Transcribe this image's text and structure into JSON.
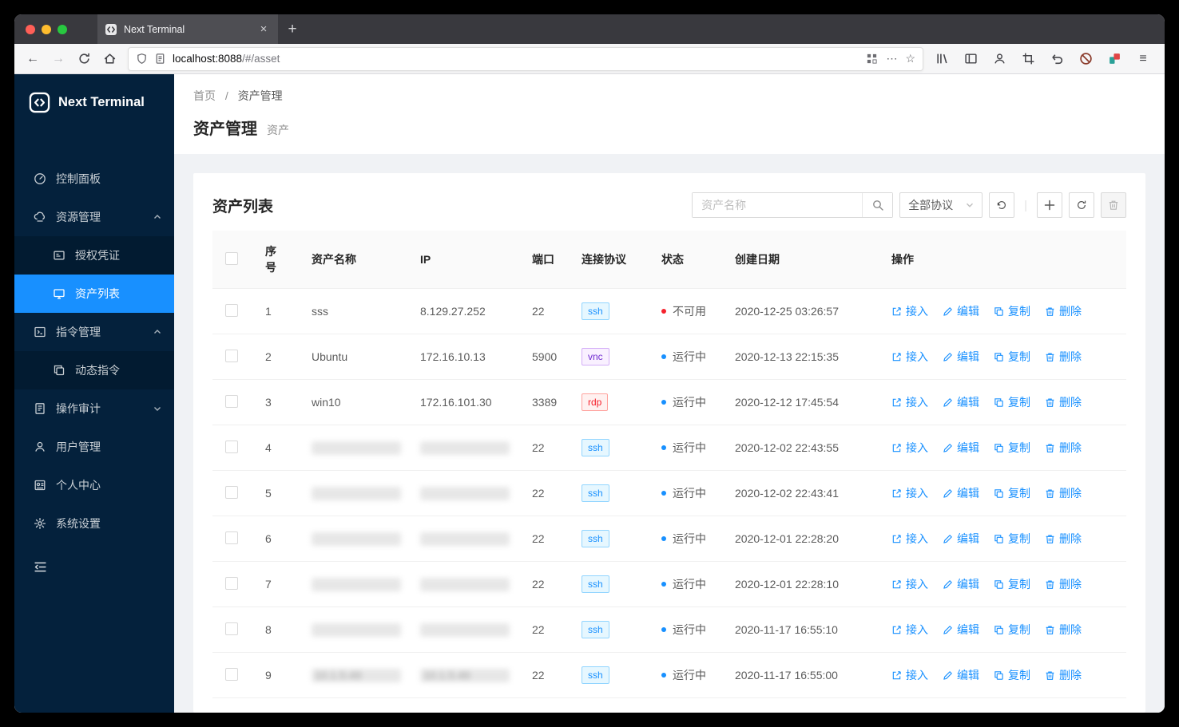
{
  "browser": {
    "tab_title": "Next Terminal",
    "url_host": "localhost:8088",
    "url_path": "/#/asset"
  },
  "sidebar": {
    "logo_text": "Next Terminal",
    "items": [
      {
        "id": "dashboard",
        "label": "控制面板"
      },
      {
        "id": "resources",
        "label": "资源管理",
        "chevron": "up"
      },
      {
        "id": "credentials",
        "label": "授权凭证",
        "child": true
      },
      {
        "id": "assets",
        "label": "资产列表",
        "child": true,
        "active": true
      },
      {
        "id": "commands",
        "label": "指令管理",
        "chevron": "up"
      },
      {
        "id": "dynamic-commands",
        "label": "动态指令",
        "child": true
      },
      {
        "id": "audit",
        "label": "操作审计",
        "chevron": "down"
      },
      {
        "id": "users",
        "label": "用户管理"
      },
      {
        "id": "profile",
        "label": "个人中心"
      },
      {
        "id": "settings",
        "label": "系统设置"
      }
    ]
  },
  "breadcrumb": {
    "home": "首页",
    "separator": "/",
    "current": "资产管理"
  },
  "page": {
    "title": "资产管理",
    "subtitle": "资产"
  },
  "card": {
    "title": "资产列表",
    "search_placeholder": "资产名称",
    "protocol_filter": "全部协议"
  },
  "table": {
    "columns": [
      "序号",
      "资产名称",
      "IP",
      "端口",
      "连接协议",
      "状态",
      "创建日期",
      "操作"
    ],
    "actions": [
      "接入",
      "编辑",
      "复制",
      "删除"
    ],
    "status_labels": {
      "error": "不可用",
      "processing": "运行中"
    },
    "rows": [
      {
        "index": "1",
        "name": "sss",
        "ip": "8.129.27.252",
        "port": "22",
        "protocol": "ssh",
        "status": "error",
        "status_text": "不可用",
        "created": "2020-12-25 03:26:57"
      },
      {
        "index": "2",
        "name": "Ubuntu",
        "ip": "172.16.10.13",
        "port": "5900",
        "protocol": "vnc",
        "status": "processing",
        "status_text": "运行中",
        "created": "2020-12-13 22:15:35"
      },
      {
        "index": "3",
        "name": "win10",
        "ip": "172.16.101.30",
        "port": "3389",
        "protocol": "rdp",
        "status": "processing",
        "status_text": "运行中",
        "created": "2020-12-12 17:45:54"
      },
      {
        "index": "4",
        "name": "",
        "ip": "",
        "redacted": true,
        "port": "22",
        "protocol": "ssh",
        "status": "processing",
        "status_text": "运行中",
        "created": "2020-12-02 22:43:55"
      },
      {
        "index": "5",
        "name": "",
        "ip": "",
        "redacted": true,
        "port": "22",
        "protocol": "ssh",
        "status": "processing",
        "status_text": "运行中",
        "created": "2020-12-02 22:43:41"
      },
      {
        "index": "6",
        "name": "",
        "ip": "",
        "redacted": true,
        "port": "22",
        "protocol": "ssh",
        "status": "processing",
        "status_text": "运行中",
        "created": "2020-12-01 22:28:20"
      },
      {
        "index": "7",
        "name": "",
        "ip": "",
        "redacted": true,
        "port": "22",
        "protocol": "ssh",
        "status": "processing",
        "status_text": "运行中",
        "created": "2020-12-01 22:28:10"
      },
      {
        "index": "8",
        "name": "",
        "ip": "",
        "redacted": true,
        "port": "22",
        "protocol": "ssh",
        "status": "processing",
        "status_text": "运行中",
        "created": "2020-11-17 16:55:10"
      },
      {
        "index": "9",
        "name": "10.1.5.49",
        "ip": "10.1.5.49",
        "redacted": true,
        "port": "22",
        "protocol": "ssh",
        "status": "processing",
        "status_text": "运行中",
        "created": "2020-11-17 16:55:00"
      }
    ]
  },
  "theme": {
    "primary": "#1890ff",
    "sidebar_bg": "#04213c",
    "submenu_bg": "#021b31",
    "status_error": "#f5222d",
    "status_processing": "#1890ff",
    "tag_ssh": {
      "text": "#1890ff",
      "bg": "#e6f7ff",
      "border": "#91d5ff"
    },
    "tag_vnc": {
      "text": "#722ed1",
      "bg": "#f9f0ff",
      "border": "#d3adf7"
    },
    "tag_rdp": {
      "text": "#f5222d",
      "bg": "#fff1f0",
      "border": "#ffa39e"
    }
  }
}
